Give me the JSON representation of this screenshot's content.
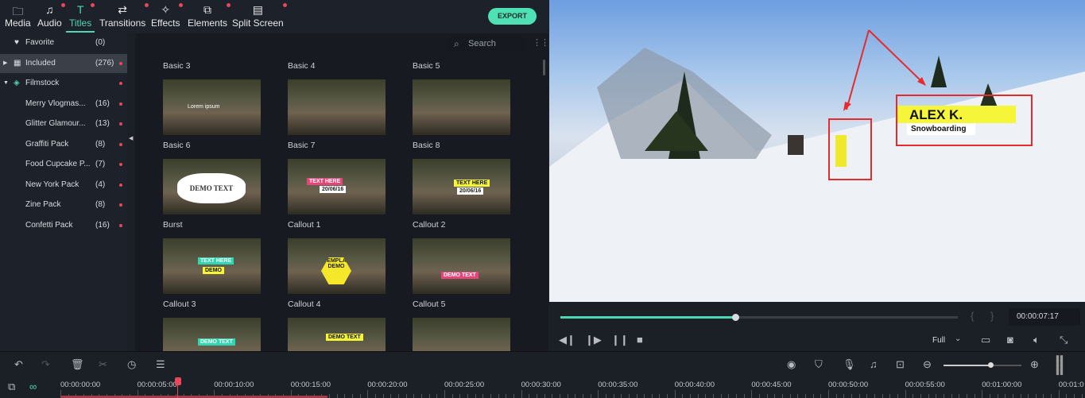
{
  "tabs": [
    {
      "label": "Media",
      "icon": "folder-icon"
    },
    {
      "label": "Audio",
      "icon": "music-icon"
    },
    {
      "label": "Titles",
      "icon": "text-icon",
      "active": true
    },
    {
      "label": "Transitions",
      "icon": "transition-icon"
    },
    {
      "label": "Effects",
      "icon": "effects-icon"
    },
    {
      "label": "Elements",
      "icon": "elements-icon"
    },
    {
      "label": "Split Screen",
      "icon": "split-screen-icon"
    }
  ],
  "export_label": "EXPORT",
  "search_placeholder": "Search",
  "sidebar": [
    {
      "label": "Favorite",
      "count": "(0)"
    },
    {
      "label": "Included",
      "count": "(276)",
      "selected": true
    },
    {
      "label": "Filmstock",
      "count": ""
    },
    {
      "label": "Merry Vlogmas...",
      "count": "(16)"
    },
    {
      "label": "Glitter Glamour...",
      "count": "(13)"
    },
    {
      "label": "Graffiti Pack",
      "count": "(8)"
    },
    {
      "label": "Food Cupcake P...",
      "count": "(7)"
    },
    {
      "label": "New York Pack",
      "count": "(4)"
    },
    {
      "label": "Zine Pack",
      "count": "(8)"
    },
    {
      "label": "Confetti Pack",
      "count": "(16)"
    }
  ],
  "titles": [
    "Basic 3",
    "Basic 4",
    "Basic 5",
    "Basic 6",
    "Basic 7",
    "Basic 8",
    "Burst",
    "Callout 1",
    "Callout 2",
    "Callout 3",
    "Callout 4",
    "Callout 5"
  ],
  "thumb_texts": {
    "basic6": "Lorem ipsum",
    "burst": "DEMO TEXT",
    "callout1": "TEXT HERE",
    "callout1_date": "20/06/16",
    "callout2": "TEXT HERE",
    "callout2_date": "20/06/16",
    "callout3": "TEXT HERE",
    "callout3_sub": "DEMO",
    "callout4": "TEMPLATE DEMO",
    "callout5": "DEMO TEXT",
    "row5a": "DEMO TEXT",
    "row5b": "DEMO TEXT"
  },
  "preview": {
    "name": "ALEX K.",
    "subtitle": "Snowboarding",
    "accent": "#f5f53a",
    "annotation_color": "#e52b2b"
  },
  "player": {
    "progress": 0.44,
    "timecode": "00:00:07:17",
    "quality": "Full"
  },
  "timeline": {
    "ticks": [
      "00:00:00:00",
      "00:00:05:00",
      "00:00:10:00",
      "00:00:15:00",
      "00:00:20:00",
      "00:00:25:00",
      "00:00:30:00",
      "00:00:35:00",
      "00:00:40:00",
      "00:00:45:00",
      "00:00:50:00",
      "00:00:55:00",
      "00:01:00:00",
      "00:01:0"
    ],
    "playhead": "00:00:05:00",
    "zoom": 0.6
  },
  "colors": {
    "accent": "#4fd6b5",
    "red": "#e5475b"
  }
}
